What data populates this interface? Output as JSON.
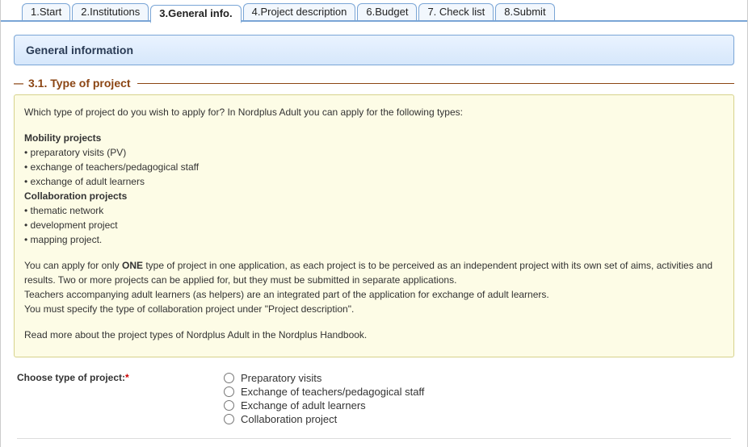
{
  "tabs": [
    {
      "label": "1.Start"
    },
    {
      "label": "2.Institutions"
    },
    {
      "label": "3.General info."
    },
    {
      "label": "4.Project description"
    },
    {
      "label": "6.Budget"
    },
    {
      "label": "7. Check list"
    },
    {
      "label": "8.Submit"
    }
  ],
  "active_tab_index": 2,
  "panel_title": "General information",
  "section": {
    "number_title": "3.1. Type of project"
  },
  "info": {
    "intro": "Which type of project do you wish to apply for? In Nordplus Adult you can apply for the following types:",
    "mobility_heading": "Mobility projects",
    "mobility_items": [
      "• preparatory visits (PV)",
      "• exchange of teachers/pedagogical staff",
      "• exchange of adult learners"
    ],
    "collab_heading": "Collaboration projects",
    "collab_items": [
      "• thematic network",
      "• development project",
      "• mapping project."
    ],
    "one_pre": "You can apply for only ",
    "one_bold": "ONE",
    "one_post": " type of project in one application, as each project is to be perceived as an independent project with its own set of aims, activities and results. Two or more projects can be applied for, but they must be submitted in separate applications.",
    "teachers_line": "Teachers accompanying adult learners (as helpers) are an integrated part of the application for exchange of adult learners.",
    "specify_line": "You must specify the type of collaboration project under \"Project description\".",
    "handbook_line": "Read more about the project types of Nordplus Adult in the Nordplus Handbook."
  },
  "form": {
    "choose_label": "Choose type of project:",
    "required_mark": "*",
    "options": [
      "Preparatory visits",
      "Exchange of teachers/pedagogical staff",
      "Exchange of adult learners",
      "Collaboration project"
    ]
  }
}
